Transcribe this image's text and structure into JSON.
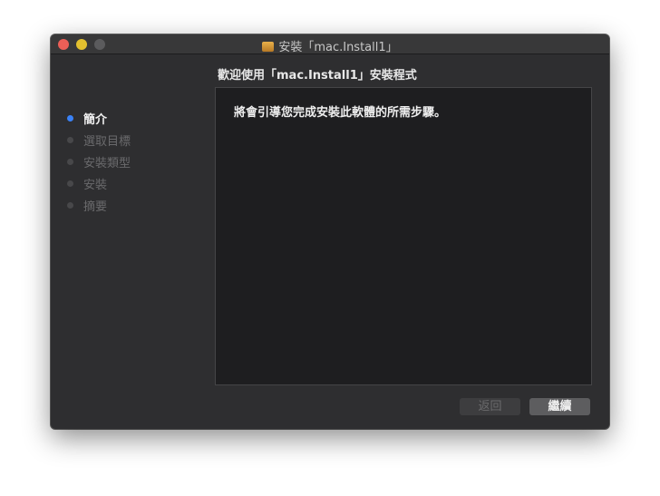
{
  "window": {
    "title": "安裝「mac.Install1」"
  },
  "heading": "歡迎使用「mac.Install1」安裝程式",
  "steps": [
    {
      "label": "簡介",
      "active": true
    },
    {
      "label": "選取目標",
      "active": false
    },
    {
      "label": "安裝類型",
      "active": false
    },
    {
      "label": "安裝",
      "active": false
    },
    {
      "label": "摘要",
      "active": false
    }
  ],
  "content": {
    "text": "將會引導您完成安裝此軟體的所需步驟。"
  },
  "buttons": {
    "back": "返回",
    "continue": "繼續"
  },
  "colors": {
    "accent": "#3a82f7",
    "close": "#ec5f57",
    "minimize": "#e2c02f"
  }
}
